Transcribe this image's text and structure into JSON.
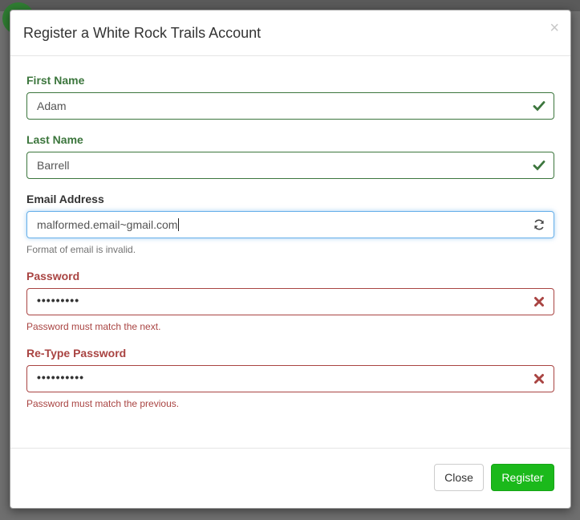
{
  "modal": {
    "title": "Register a White Rock Trails Account",
    "close_symbol": "×"
  },
  "form": {
    "first_name": {
      "label": "First Name",
      "value": "Adam",
      "status": "success"
    },
    "last_name": {
      "label": "Last Name",
      "value": "Barrell",
      "status": "success"
    },
    "email": {
      "label": "Email Address",
      "value": "malformed.email~gmail.com",
      "status": "validating",
      "help": "Format of email is invalid."
    },
    "password": {
      "label": "Password",
      "value": "•••••••••",
      "status": "error",
      "help": "Password must match the next."
    },
    "retype_password": {
      "label": "Re-Type Password",
      "value": "••••••••••",
      "status": "error",
      "help": "Password must match the previous."
    }
  },
  "footer": {
    "close_label": "Close",
    "register_label": "Register"
  },
  "colors": {
    "success": "#3c763d",
    "error": "#a94442",
    "primary_button": "#1bb91b"
  },
  "icons": {
    "success": "check-icon",
    "validating": "refresh-icon",
    "error": "times-icon"
  }
}
